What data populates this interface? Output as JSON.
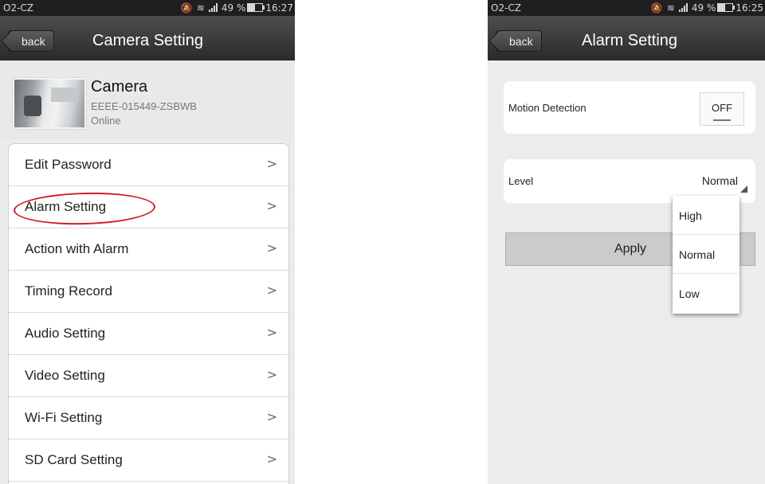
{
  "status_bar": {
    "carrier": "O2-CZ",
    "battery_percent": "49 %",
    "left_time": "16:27",
    "right_time": "16:25"
  },
  "camera_setting": {
    "back_label": "back",
    "title": "Camera Setting",
    "camera": {
      "name": "Camera",
      "id": "EEEE-015449-ZSBWB",
      "status": "Online"
    },
    "menu_items": [
      {
        "label": "Edit Password"
      },
      {
        "label": "Alarm Setting"
      },
      {
        "label": "Action with Alarm"
      },
      {
        "label": "Timing Record"
      },
      {
        "label": "Audio Setting"
      },
      {
        "label": "Video Setting"
      },
      {
        "label": "Wi-Fi Setting"
      },
      {
        "label": "SD Card Setting"
      }
    ],
    "chevron": ">",
    "highlighted_item": "Alarm Setting"
  },
  "alarm_setting": {
    "back_label": "back",
    "title": "Alarm Setting",
    "motion_detection": {
      "label": "Motion Detection",
      "value": "OFF"
    },
    "level": {
      "label": "Level",
      "value": "Normal"
    },
    "apply_label": "Apply",
    "level_options": [
      {
        "label": "High"
      },
      {
        "label": "Normal"
      },
      {
        "label": "Low"
      }
    ]
  },
  "colors": {
    "titlebar": "#333333",
    "highlight_circle": "#d01c24",
    "background": "#ebebeb"
  }
}
